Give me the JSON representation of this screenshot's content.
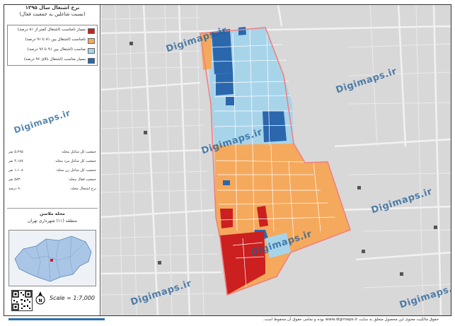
{
  "title_line1": "نرخ اشتغال سال ۱۳۹۵",
  "title_line2": "(نسبت شاغلین به جمعیت فعال)",
  "legend": [
    {
      "label": "بسیار نامناسب (اشتغال کمتر از ۸۱ درصد)",
      "color": "#cc1f1f"
    },
    {
      "label": "نامناسب (اشتغال بین ۸۱ تا ۹۱ درصد)",
      "color": "#f5a95c"
    },
    {
      "label": "مناسب (اشتغال بین ۹۱ تا ۹۶ درصد)",
      "color": "#a8d4ea"
    },
    {
      "label": "بسیار مناسب (اشتغال بالای ۹۶ درصد)",
      "color": "#2a67ad"
    }
  ],
  "stats": [
    {
      "label": "جمعیت کل شاغل محله:",
      "value": "۵،۲۹۵ نفر"
    },
    {
      "label": "جمعیت کل شاغل مرد محله:",
      "value": "۴،۱۸۷ نفر"
    },
    {
      "label": "جمعیت کل شاغل زن محله:",
      "value": "۱،۱۰۸ نفر"
    },
    {
      "label": "جمعیت فعال محله:",
      "value": "۵۸۳۰ نفر"
    },
    {
      "label": "نرخ اشتغال محله:",
      "value": "۹۰ درصد"
    }
  ],
  "area_name": "محله ملاسن",
  "area_district": "منطقه (۱۱) شهرداری تهران",
  "scale": "Scale = 1:7,000",
  "watermark": "Digimaps.ir",
  "footer": "حقوق مالکیت معنوی این محصول متعلق به سایت www.digimaps.ir بوده و تمامی حقوق آن محفوظ است.",
  "colors": {
    "very_poor": "#cc1f1f",
    "poor": "#f5a95c",
    "good": "#a8d4ea",
    "very_good": "#2a67ad",
    "boundary": "#f08080",
    "base_map": "#d8d8d8"
  }
}
